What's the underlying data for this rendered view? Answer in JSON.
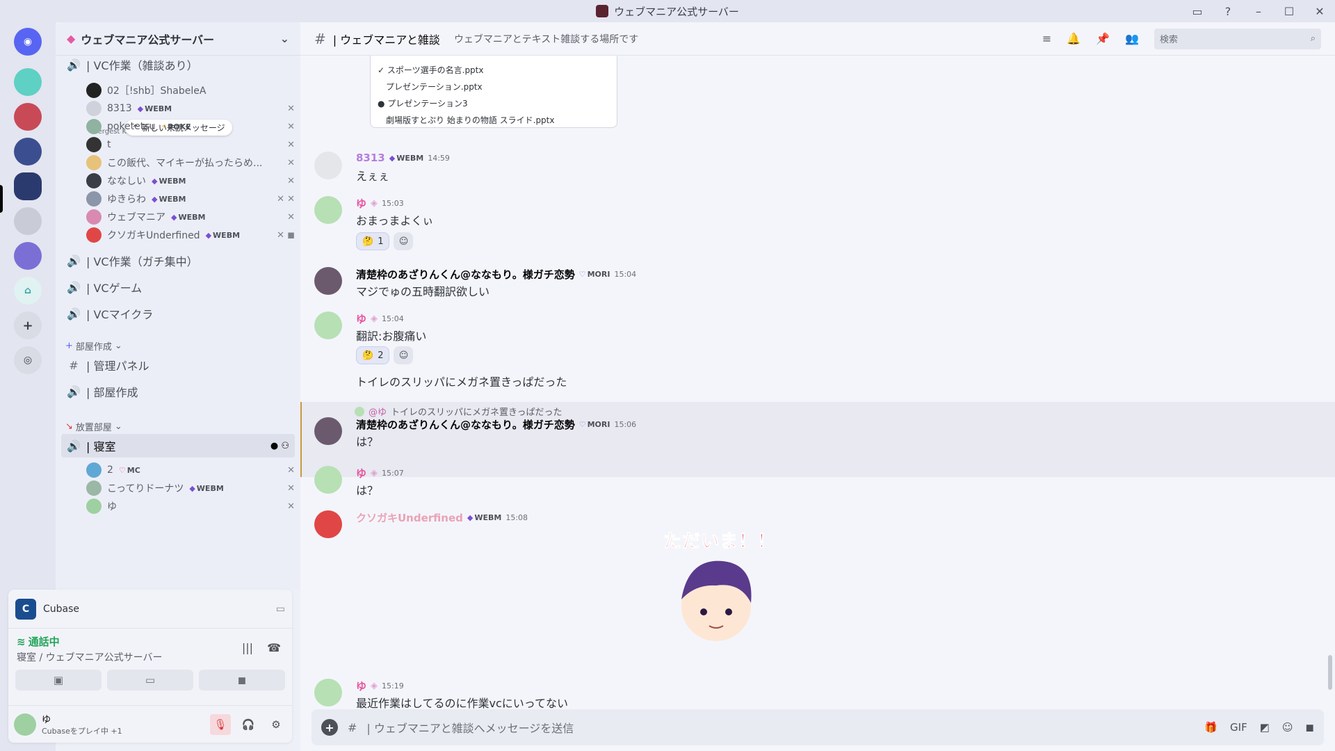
{
  "window": {
    "title": "ウェブマニア公式サーバー"
  },
  "server": {
    "name": "ウェブマニア公式サーバー"
  },
  "sidebar": {
    "top_channel": "| VC作業（雑談あり）",
    "new_unread": "^ 新しい未読メッセージ",
    "subtext": "Mergest Kingdom",
    "voice_users_top": [
      {
        "name": "02［!shb］ShabeleA",
        "tag": ""
      },
      {
        "name": "8313",
        "tag": "WEBM"
      },
      {
        "name": "poketetsu",
        "tag": "POKE"
      },
      {
        "name": "t",
        "tag": ""
      },
      {
        "name": "この飯代、マイキーが払ったらめ...",
        "tag": ""
      },
      {
        "name": "ななしい",
        "tag": "WEBM"
      },
      {
        "name": "ゆきらわ",
        "tag": "WEBM"
      },
      {
        "name": "ウェブマニア",
        "tag": "WEBM"
      },
      {
        "name": "クソガキUnderfined",
        "tag": "WEBM"
      }
    ],
    "channels": [
      {
        "label": "| VC作業（ガチ集中）"
      },
      {
        "label": "| VCゲーム"
      },
      {
        "label": "| VCマイクラ"
      }
    ],
    "category1": "部屋作成",
    "cat1_channels": [
      {
        "label": "| 管理パネル"
      },
      {
        "label": "| 部屋作成"
      }
    ],
    "category2": "放置部屋",
    "active_channel": "| 寝室",
    "voice_users_bottom": [
      {
        "name": "2",
        "tag": "MC"
      },
      {
        "name": "こってりドーナツ",
        "tag": "WEBM"
      },
      {
        "name": "ゆ",
        "tag": ""
      }
    ]
  },
  "activity": {
    "app": "Cubase"
  },
  "voice": {
    "status": "通話中",
    "location": "寝室 / ウェブマニア公式サーバー"
  },
  "user": {
    "name": "ゆ",
    "status": "Cubaseをプレイ中 +1"
  },
  "channel": {
    "name": "| ウェブマニアと雑談",
    "topic": "ウェブマニアとテキスト雑談する場所です",
    "search_placeholder": "検索",
    "input_placeholder": "| ウェブマニアと雑談へメッセージを送信"
  },
  "popup_menu": [
    "✓ スポーツ選手の名言.pptx",
    "プレゼンテーション.pptx",
    "● プレゼンテーション3",
    "劇場版すとぷり 始まりの物語 スライド.pptx"
  ],
  "messages": [
    {
      "author": "8313",
      "tag": "WEBM",
      "time": "14:59",
      "text": "えぇぇ",
      "color": "#b57edc"
    },
    {
      "author": "ゆ",
      "tag": "",
      "time": "15:03",
      "text": "おまっまよくぃ",
      "reaction": "1",
      "color": "#e8539e"
    },
    {
      "author": "清楚枠のあざりんくん@ななもり。様ガチ恋勢",
      "tag": "MORI",
      "time": "15:04",
      "text": "マジでゅの五時翻訳欲しい",
      "color": "#060607"
    },
    {
      "author": "ゆ",
      "tag": "",
      "time": "15:04",
      "text": "翻訳:お腹痛い",
      "reaction": "2",
      "extra": "トイレのスリッパにメガネ置きっぱだった",
      "color": "#e8539e"
    },
    {
      "author": "清楚枠のあざりんくん@ななもり。様ガチ恋勢",
      "tag": "MORI",
      "time": "15:06",
      "text": "は？",
      "reply_to": "@ゆ",
      "reply_text": "トイレのスリッパにメガネ置きっぱだった",
      "color": "#060607"
    },
    {
      "author": "ゆ",
      "tag": "",
      "time": "15:07",
      "text": "は？",
      "color": "#e8539e"
    },
    {
      "author": "クソガキUnderfined",
      "tag": "WEBM",
      "time": "15:08",
      "text": "",
      "sticker_text": "ただいま！！",
      "color": "#e9a3b5"
    },
    {
      "author": "ゆ",
      "tag": "",
      "time": "15:19",
      "text": "最近作業はしてるのに作業vcにいってない",
      "color": "#e8539e"
    }
  ],
  "colors": {
    "accent": "#5865f2",
    "online": "#23a55a",
    "danger": "#da373c"
  }
}
